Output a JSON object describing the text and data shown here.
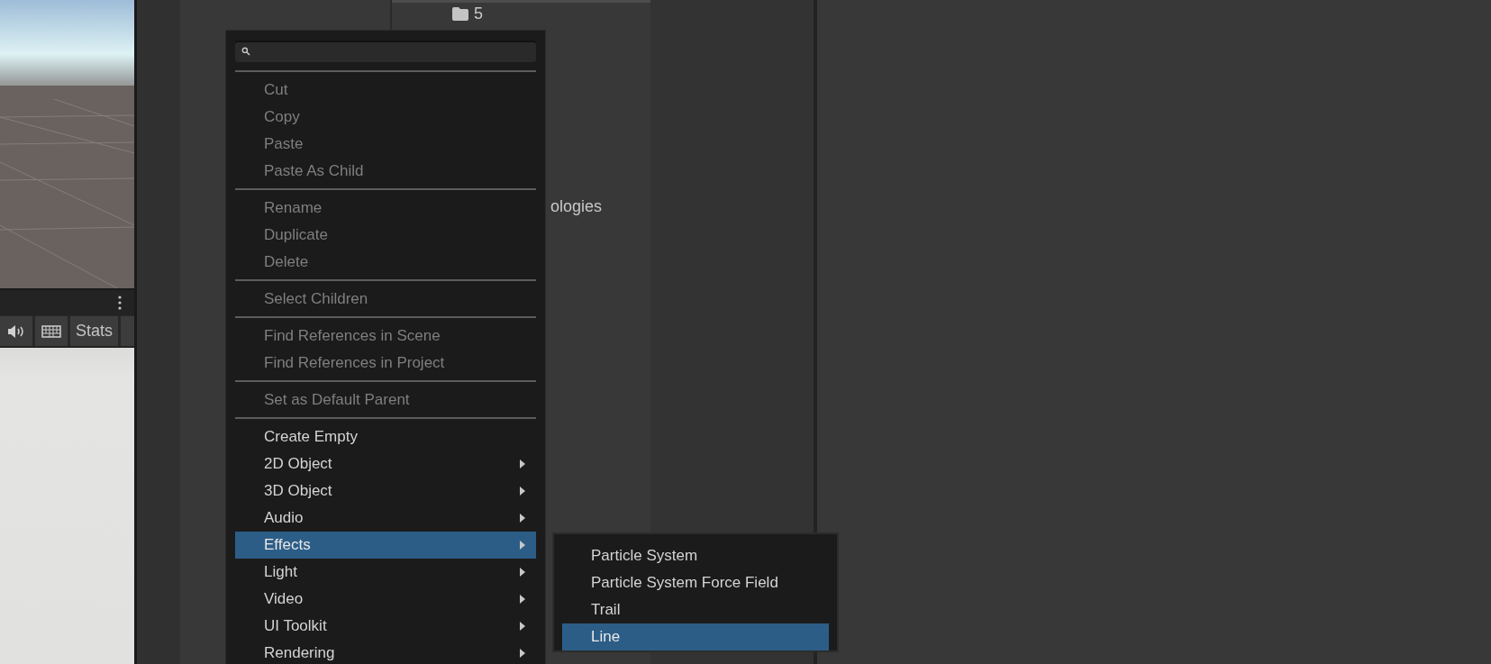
{
  "game_toolbar": {
    "buttons": [
      "Stats"
    ]
  },
  "hierarchy": {
    "items": [
      {
        "label": "5",
        "kind": "folder"
      },
      {
        "label": "ologies",
        "kind": "text"
      }
    ]
  },
  "context_menu": {
    "groups": [
      {
        "items": [
          {
            "label": "Cut",
            "disabled": true,
            "submenu": false,
            "selected": false
          },
          {
            "label": "Copy",
            "disabled": true,
            "submenu": false,
            "selected": false
          },
          {
            "label": "Paste",
            "disabled": true,
            "submenu": false,
            "selected": false
          },
          {
            "label": "Paste As Child",
            "disabled": true,
            "submenu": false,
            "selected": false
          }
        ]
      },
      {
        "items": [
          {
            "label": "Rename",
            "disabled": true,
            "submenu": false,
            "selected": false
          },
          {
            "label": "Duplicate",
            "disabled": true,
            "submenu": false,
            "selected": false
          },
          {
            "label": "Delete",
            "disabled": true,
            "submenu": false,
            "selected": false
          }
        ]
      },
      {
        "items": [
          {
            "label": "Select Children",
            "disabled": true,
            "submenu": false,
            "selected": false
          }
        ]
      },
      {
        "items": [
          {
            "label": "Find References in Scene",
            "disabled": true,
            "submenu": false,
            "selected": false
          },
          {
            "label": "Find References in Project",
            "disabled": true,
            "submenu": false,
            "selected": false
          }
        ]
      },
      {
        "items": [
          {
            "label": "Set as Default Parent",
            "disabled": true,
            "submenu": false,
            "selected": false
          }
        ]
      },
      {
        "items": [
          {
            "label": "Create Empty",
            "disabled": false,
            "submenu": false,
            "selected": false
          },
          {
            "label": "2D Object",
            "disabled": false,
            "submenu": true,
            "selected": false
          },
          {
            "label": "3D Object",
            "disabled": false,
            "submenu": true,
            "selected": false
          },
          {
            "label": "Audio",
            "disabled": false,
            "submenu": true,
            "selected": false
          },
          {
            "label": "Effects",
            "disabled": false,
            "submenu": true,
            "selected": true
          },
          {
            "label": "Light",
            "disabled": false,
            "submenu": true,
            "selected": false
          },
          {
            "label": "Video",
            "disabled": false,
            "submenu": true,
            "selected": false
          },
          {
            "label": "UI Toolkit",
            "disabled": false,
            "submenu": true,
            "selected": false
          },
          {
            "label": "Rendering",
            "disabled": false,
            "submenu": true,
            "selected": false
          }
        ]
      }
    ]
  },
  "submenu": {
    "items": [
      {
        "label": "Particle System",
        "selected": false
      },
      {
        "label": "Particle System Force Field",
        "selected": false
      },
      {
        "label": "Trail",
        "selected": false
      },
      {
        "label": "Line",
        "selected": true
      }
    ]
  }
}
